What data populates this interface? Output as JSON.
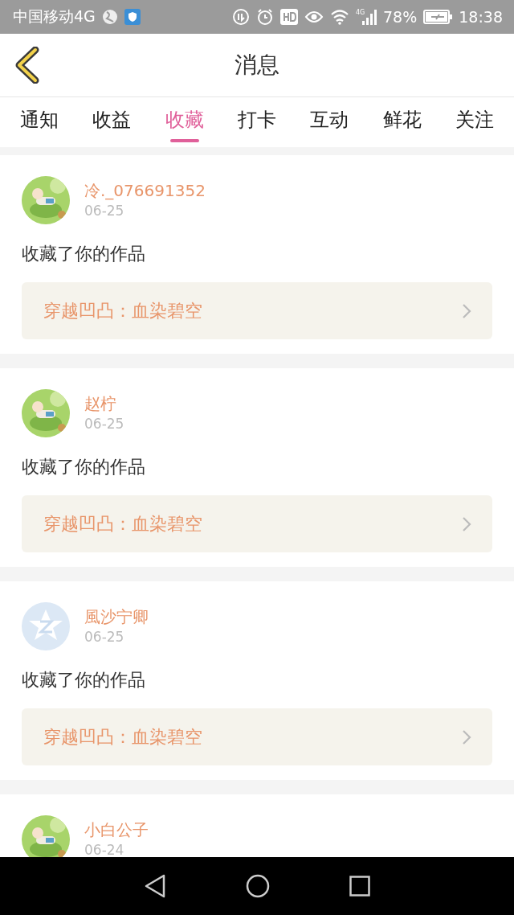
{
  "status_bar": {
    "carrier": "中国移动4G",
    "network": "4G",
    "battery": "78%",
    "time": "18:38"
  },
  "header": {
    "title": "消息"
  },
  "tabs": [
    {
      "label": "通知",
      "selected": false
    },
    {
      "label": "收益",
      "selected": false
    },
    {
      "label": "收藏",
      "selected": true
    },
    {
      "label": "打卡",
      "selected": false
    },
    {
      "label": "互动",
      "selected": false
    },
    {
      "label": "鲜花",
      "selected": false
    },
    {
      "label": "关注",
      "selected": false
    }
  ],
  "messages": [
    {
      "name": "冷._076691352",
      "date": "06-25",
      "action": "收藏了你的作品",
      "work": "穿越凹凸：血染碧空"
    },
    {
      "name": "赵柠",
      "date": "06-25",
      "action": "收藏了你的作品",
      "work": "穿越凹凸：血染碧空"
    },
    {
      "avatar": {
        "kind": "default"
      },
      "name": "風沙宁卿",
      "date": "06-25",
      "action": "收藏了你的作品",
      "work": "穿越凹凸：血染碧空"
    },
    {
      "name": "小白公子",
      "date": "06-24"
    }
  ]
}
